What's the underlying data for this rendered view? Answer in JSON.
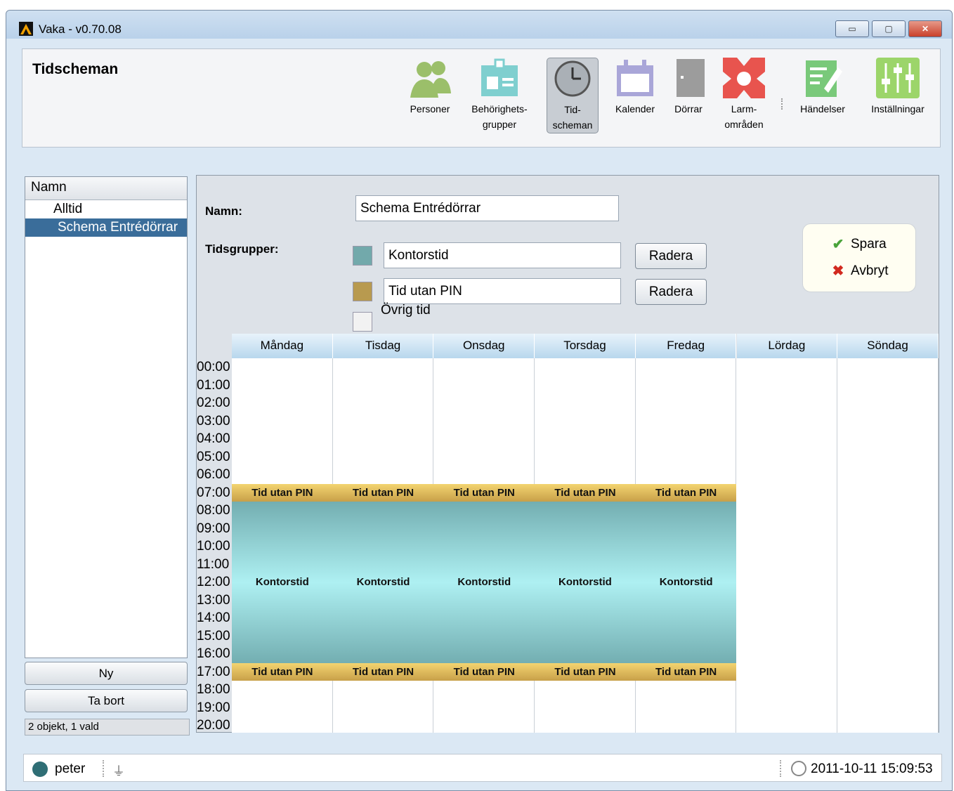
{
  "window": {
    "title": "Vaka - v0.70.08",
    "controls": {
      "minimize": "▭",
      "maximize": "▢",
      "close": "✕"
    }
  },
  "header": {
    "page_title": "Tidscheman"
  },
  "toolbar": {
    "items": [
      {
        "line1": "Personer",
        "line2": "",
        "icon": "people-icon",
        "color": "#9bbf6a"
      },
      {
        "line1": "Behörighets-",
        "line2": "grupper",
        "icon": "badge-icon",
        "color": "#7fcfcf"
      },
      {
        "line1": "Tid-",
        "line2": "scheman",
        "icon": "clock-icon",
        "color": "#888888"
      },
      {
        "line1": "Kalender",
        "line2": "",
        "icon": "calendar-icon",
        "color": "#a9a6d8"
      },
      {
        "line1": "Dörrar",
        "line2": "",
        "icon": "door-icon",
        "color": "#9c9c9c"
      },
      {
        "line1": "Larm-",
        "line2": "områden",
        "icon": "alarm-area-icon",
        "color": "#e8544e"
      },
      {
        "line1": "Händelser",
        "line2": "",
        "icon": "events-icon",
        "color": "#79c97a"
      },
      {
        "line1": "Inställningar",
        "line2": "",
        "icon": "settings-icon",
        "color": "#9cd56a"
      }
    ],
    "active_index": 2
  },
  "sidebar": {
    "header": "Namn",
    "items": [
      {
        "label": "Alltid",
        "selected": false
      },
      {
        "label": "Schema Entrédörrar",
        "selected": true
      }
    ],
    "new_button": "Ny",
    "delete_button": "Ta bort",
    "status": "2 objekt, 1 vald"
  },
  "form": {
    "name_label": "Namn:",
    "name_value": "Schema Entrédörrar",
    "groups_label": "Tidsgrupper:",
    "groups": [
      {
        "name": "Kontorstid",
        "color": "#72a9ab",
        "delete_label": "Radera"
      },
      {
        "name": "Tid utan PIN",
        "color": "#b89a4f",
        "delete_label": "Radera"
      }
    ],
    "other_time": {
      "label": "Övrig tid",
      "color": "#f2f2f2"
    },
    "save_label": "Spara",
    "cancel_label": "Avbryt"
  },
  "calendar": {
    "days": [
      "Måndag",
      "Tisdag",
      "Onsdag",
      "Torsdag",
      "Fredag",
      "Lördag",
      "Söndag"
    ],
    "hours": [
      "00:00",
      "01:00",
      "02:00",
      "03:00",
      "04:00",
      "05:00",
      "06:00",
      "07:00",
      "08:00",
      "09:00",
      "10:00",
      "11:00",
      "12:00",
      "13:00",
      "14:00",
      "15:00",
      "16:00",
      "17:00",
      "18:00",
      "19:00",
      "20:00"
    ],
    "blocks": [
      {
        "day": 0,
        "start": 7,
        "end": 8,
        "label": "Tid utan PIN",
        "type": "gold"
      },
      {
        "day": 0,
        "start": 8,
        "end": 17,
        "label": "Kontorstid",
        "type": "teal"
      },
      {
        "day": 0,
        "start": 17,
        "end": 18,
        "label": "Tid utan PIN",
        "type": "gold"
      },
      {
        "day": 1,
        "start": 7,
        "end": 8,
        "label": "Tid utan PIN",
        "type": "gold"
      },
      {
        "day": 1,
        "start": 8,
        "end": 17,
        "label": "Kontorstid",
        "type": "teal"
      },
      {
        "day": 1,
        "start": 17,
        "end": 18,
        "label": "Tid utan PIN",
        "type": "gold"
      },
      {
        "day": 2,
        "start": 7,
        "end": 8,
        "label": "Tid utan PIN",
        "type": "gold"
      },
      {
        "day": 2,
        "start": 8,
        "end": 17,
        "label": "Kontorstid",
        "type": "teal"
      },
      {
        "day": 2,
        "start": 17,
        "end": 18,
        "label": "Tid utan PIN",
        "type": "gold"
      },
      {
        "day": 3,
        "start": 7,
        "end": 8,
        "label": "Tid utan PIN",
        "type": "gold"
      },
      {
        "day": 3,
        "start": 8,
        "end": 17,
        "label": "Kontorstid",
        "type": "teal"
      },
      {
        "day": 3,
        "start": 17,
        "end": 18,
        "label": "Tid utan PIN",
        "type": "gold"
      },
      {
        "day": 4,
        "start": 7,
        "end": 8,
        "label": "Tid utan PIN",
        "type": "gold"
      },
      {
        "day": 4,
        "start": 8,
        "end": 17,
        "label": "Kontorstid",
        "type": "teal"
      },
      {
        "day": 4,
        "start": 17,
        "end": 18,
        "label": "Tid utan PIN",
        "type": "gold"
      }
    ]
  },
  "statusbar": {
    "user": "peter",
    "datetime": "2011-10-11 15:09:53"
  }
}
